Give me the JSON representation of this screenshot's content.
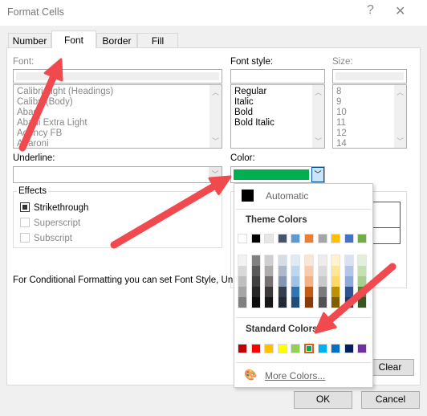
{
  "window": {
    "title": "Format Cells",
    "help": "?",
    "close": "✕"
  },
  "tabs": [
    {
      "label": "Number"
    },
    {
      "label": "Font"
    },
    {
      "label": "Border"
    },
    {
      "label": "Fill"
    }
  ],
  "font": {
    "label": "Font:",
    "value": "",
    "items": [
      "Calibri Light (Headings)",
      "Calibri (Body)",
      "Abadi",
      "Abadi Extra Light",
      "Agency FB",
      "Aharoni"
    ]
  },
  "font_style": {
    "label": "Font style:",
    "value": "",
    "items": [
      "Regular",
      "Italic",
      "Bold",
      "Bold Italic"
    ]
  },
  "size": {
    "label": "Size:",
    "value": "",
    "items": [
      "8",
      "9",
      "10",
      "11",
      "12",
      "14"
    ]
  },
  "underline": {
    "label": "Underline:",
    "value": ""
  },
  "color": {
    "label": "Color:",
    "selected": "#00b050"
  },
  "effects": {
    "label": "Effects",
    "items": [
      {
        "label": "Strikethrough",
        "state": "indeterminate"
      },
      {
        "label": "Superscript",
        "state": "disabled"
      },
      {
        "label": "Subscript",
        "state": "disabled"
      }
    ]
  },
  "note": "For Conditional Formatting you can set Font Style, Un",
  "clear_label": "Clear",
  "ok_label": "OK",
  "cancel_label": "Cancel",
  "color_popup": {
    "automatic_label": "Automatic",
    "theme_label": "Theme Colors",
    "theme_colors": [
      "#ffffff",
      "#000000",
      "#e7e6e6",
      "#44546a",
      "#5b9bd5",
      "#ed7d31",
      "#a5a5a5",
      "#ffc000",
      "#4472c4",
      "#70ad47"
    ],
    "theme_shades": [
      [
        "#f2f2f2",
        "#d9d9d9",
        "#bfbfbf",
        "#a6a6a6",
        "#808080"
      ],
      [
        "#808080",
        "#595959",
        "#404040",
        "#262626",
        "#0d0d0d"
      ],
      [
        "#d0cece",
        "#aeabab",
        "#757171",
        "#3a3838",
        "#171616"
      ],
      [
        "#d6dce4",
        "#adb9ca",
        "#8496b0",
        "#333f4f",
        "#222a35"
      ],
      [
        "#deebf6",
        "#bdd7ee",
        "#9dc3e6",
        "#2e75b5",
        "#1f4e79"
      ],
      [
        "#fbe5d5",
        "#f7cbac",
        "#f4b183",
        "#c55a11",
        "#843c0b"
      ],
      [
        "#ededed",
        "#dbdbdb",
        "#c9c9c9",
        "#7b7b7b",
        "#525252"
      ],
      [
        "#fff2cc",
        "#ffe598",
        "#ffd966",
        "#bf9000",
        "#7f6000"
      ],
      [
        "#d9e2f3",
        "#b4c6e7",
        "#8eaadb",
        "#2f5496",
        "#1f3864"
      ],
      [
        "#e2efd9",
        "#c5e0b3",
        "#a8d08d",
        "#538135",
        "#375623"
      ]
    ],
    "standard_label": "Standard Colors",
    "standard_colors": [
      "#c00000",
      "#ff0000",
      "#ffc000",
      "#ffff00",
      "#92d050",
      "#00b050",
      "#00b0f0",
      "#0070c0",
      "#002060",
      "#7030a0"
    ],
    "more_label": "More Colors..."
  },
  "annotation_color": "#f04a4f"
}
